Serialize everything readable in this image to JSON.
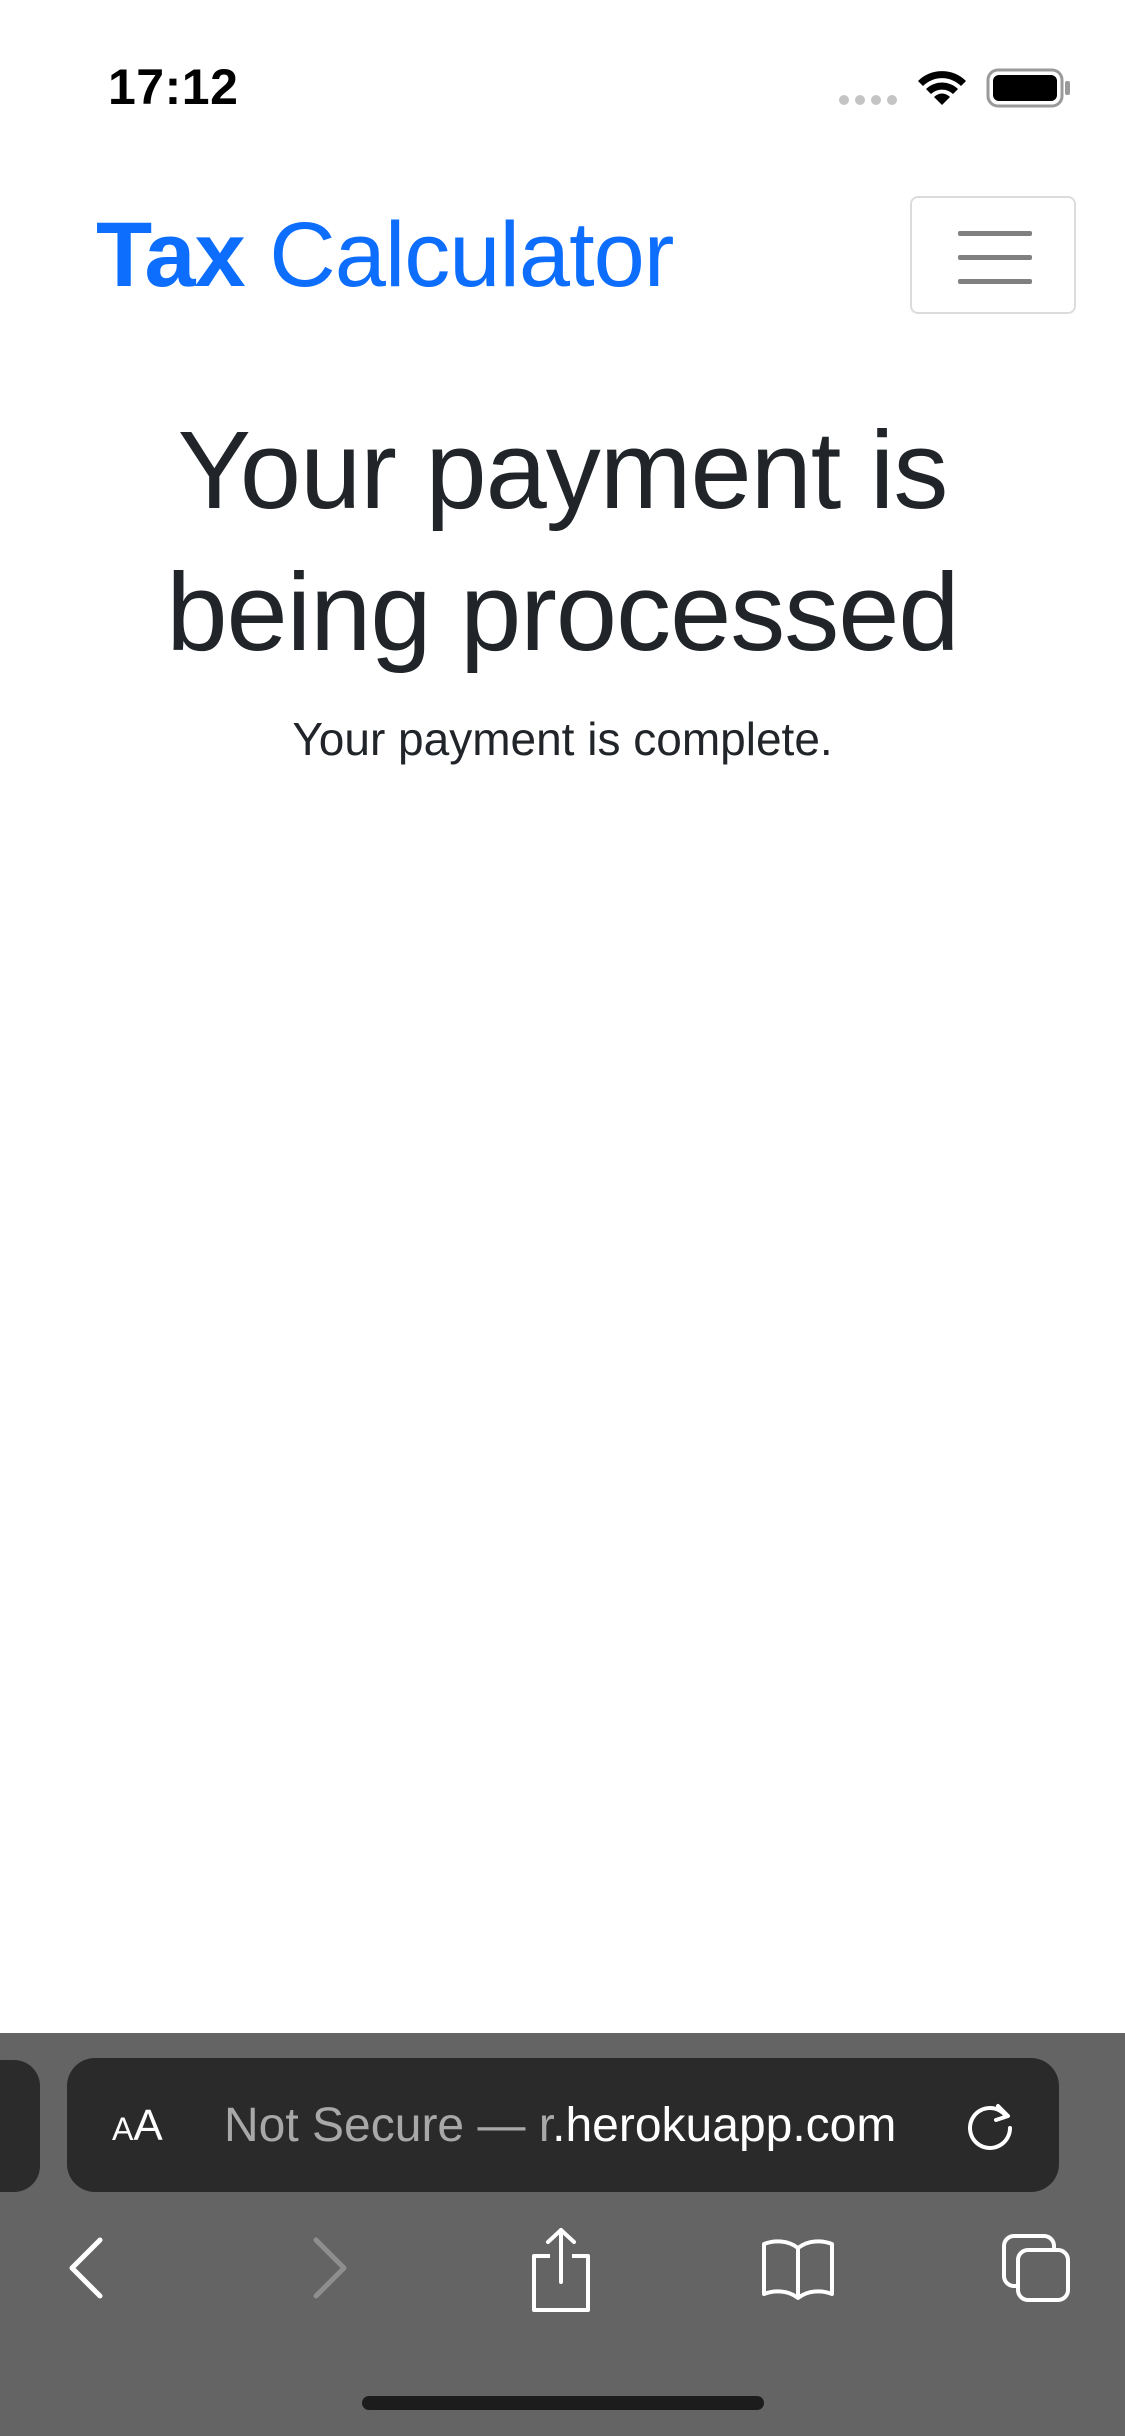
{
  "status_bar": {
    "time": "17:12",
    "icons": [
      "signal-dots-icon",
      "wifi-icon",
      "battery-icon"
    ]
  },
  "navbar": {
    "brand_word1": "Tax",
    "brand_word2": "Calculator",
    "brand_color": "#0d6efd",
    "menu_icon": "hamburger-menu-icon"
  },
  "main": {
    "heading_line1": "Your payment is",
    "heading_line2": "being processed",
    "message": "Your payment is complete."
  },
  "browser": {
    "aa_small": "A",
    "aa_large": "A",
    "url_prefix": "Not Secure — ",
    "url_partial": "r",
    "url_domain": ".herokuapp.com",
    "reload_icon": "reload-icon",
    "toolbar_icons": [
      "back-icon",
      "forward-icon",
      "share-icon",
      "bookmarks-icon",
      "tabs-icon"
    ],
    "toolbar_color": "#646464"
  }
}
